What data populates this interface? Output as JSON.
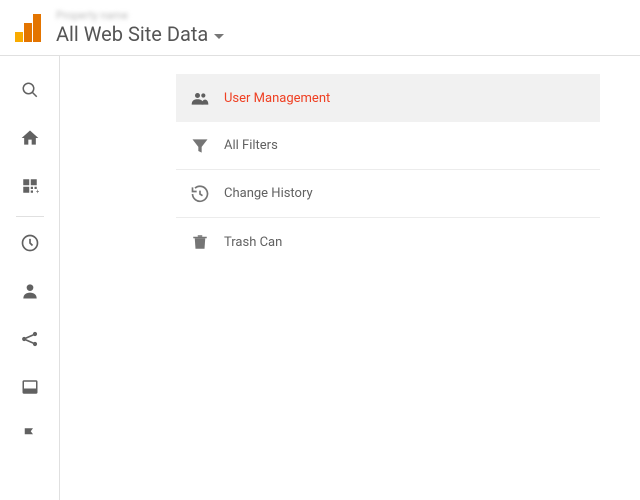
{
  "header": {
    "property_label": "Property name",
    "view_name": "All Web Site Data"
  },
  "admin_list": {
    "user_management": "User Management",
    "all_filters": "All Filters",
    "change_history": "Change History",
    "trash_can": "Trash Can"
  }
}
